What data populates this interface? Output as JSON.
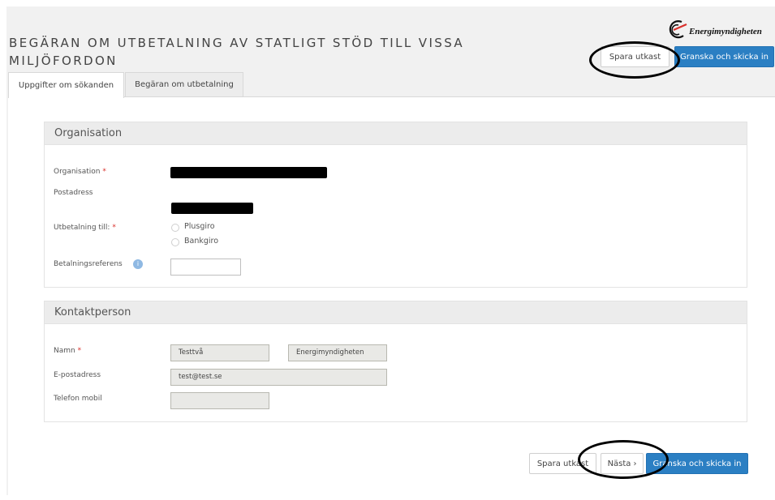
{
  "header": {
    "title_line1": "BEGÄRAN OM UTBETALNING AV STATLIGT STÖD TILL VISSA",
    "title_line2": "MILJÖFORDON",
    "logo_text": "Energimyndigheten",
    "save_draft_label": "Spara utkast",
    "review_submit_label": "Granska och skicka in"
  },
  "tabs": [
    {
      "label": "Uppgifter om sökanden",
      "active": true
    },
    {
      "label": "Begäran om utbetalning",
      "active": false
    }
  ],
  "organisation": {
    "heading": "Organisation",
    "org_label": "Organisation",
    "required_mark": "*",
    "address_label": "Postadress",
    "payment_to_label": "Utbetalning till:",
    "payment_options": [
      "Plusgiro",
      "Bankgiro"
    ],
    "payment_ref_label": "Betalningsreferens",
    "payment_ref_value": ""
  },
  "contact": {
    "heading": "Kontaktperson",
    "name_label": "Namn",
    "required_mark": "*",
    "first_name": "Testtvå",
    "last_name": "Energimyndigheten",
    "email_label": "E-postadress",
    "email": "test@test.se",
    "phone_label": "Telefon mobil",
    "phone": ""
  },
  "footer": {
    "save_draft_label": "Spara utkast",
    "next_label": "Nästa",
    "review_submit_label": "Granska och skicka in"
  },
  "colors": {
    "primary_button": "#2b7fc3",
    "required": "#d9302b",
    "annotation": "#000000"
  }
}
